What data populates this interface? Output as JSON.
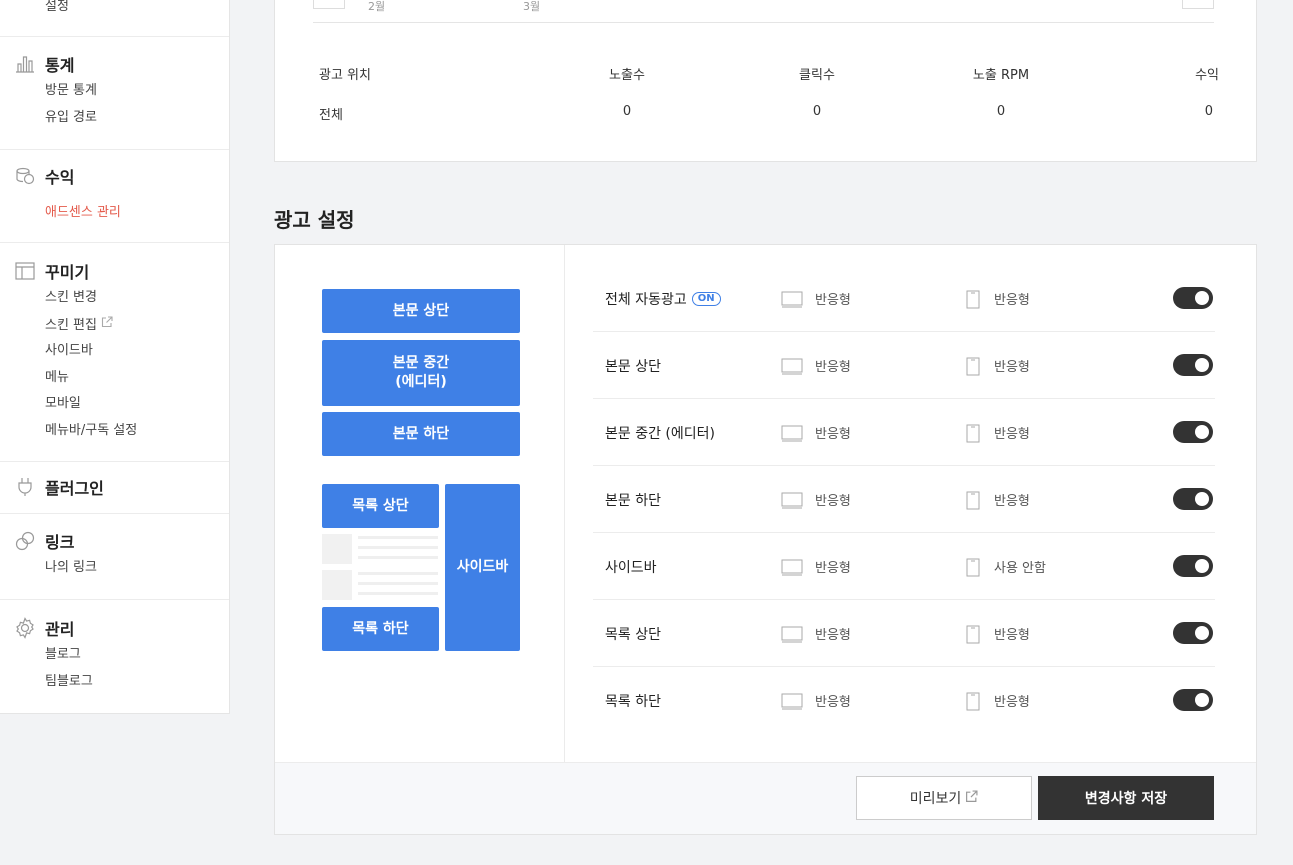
{
  "sidebar": {
    "settings_item": "설정",
    "stats": {
      "title": "통계",
      "icon": "bar-chart-icon",
      "items": [
        "방문 통계",
        "유입 경로"
      ]
    },
    "revenue": {
      "title": "수익",
      "icon": "coins-icon",
      "items": [
        "애드센스 관리"
      ]
    },
    "decorate": {
      "title": "꾸미기",
      "icon": "layout-icon",
      "items": [
        "스킨 변경",
        "스킨 편집",
        "사이드바",
        "메뉴",
        "모바일",
        "메뉴바/구독 설정"
      ]
    },
    "plugin": {
      "title": "플러그인",
      "icon": "plug-icon"
    },
    "link": {
      "title": "링크",
      "icon": "link-icon",
      "items": [
        "나의 링크"
      ]
    },
    "manage": {
      "title": "관리",
      "icon": "gear-icon",
      "items": [
        "블로그",
        "팀블로그"
      ]
    },
    "active_color": "#e45b4c"
  },
  "stats_card": {
    "months": [
      "2월",
      "3월"
    ],
    "headers": [
      "광고 위치",
      "노출수",
      "클릭수",
      "노출 RPM",
      "수익"
    ],
    "total_row": [
      "전체",
      "0",
      "0",
      "0",
      "0"
    ]
  },
  "ad_settings": {
    "title": "광고 설정",
    "preview": {
      "body_top": "본문 상단",
      "body_middle_line1": "본문 중간",
      "body_middle_line2": "(에디터)",
      "body_bottom": "본문 하단",
      "list_top": "목록 상단",
      "list_bottom": "목록 하단",
      "sidebar": "사이드바",
      "block_color": "#3f80e6"
    },
    "on_badge": "ON",
    "rows": [
      {
        "name": "전체 자동광고",
        "pc": "반응형",
        "mobile": "반응형",
        "enabled": true
      },
      {
        "name": "본문 상단",
        "pc": "반응형",
        "mobile": "반응형",
        "enabled": true
      },
      {
        "name": "본문 중간 (에디터)",
        "pc": "반응형",
        "mobile": "반응형",
        "enabled": true
      },
      {
        "name": "본문 하단",
        "pc": "반응형",
        "mobile": "반응형",
        "enabled": true
      },
      {
        "name": "사이드바",
        "pc": "반응형",
        "mobile": "사용 안함",
        "enabled": true
      },
      {
        "name": "목록 상단",
        "pc": "반응형",
        "mobile": "반응형",
        "enabled": true
      },
      {
        "name": "목록 하단",
        "pc": "반응형",
        "mobile": "반응형",
        "enabled": true
      }
    ],
    "preview_button": "미리보기",
    "save_button": "변경사항 저장"
  }
}
